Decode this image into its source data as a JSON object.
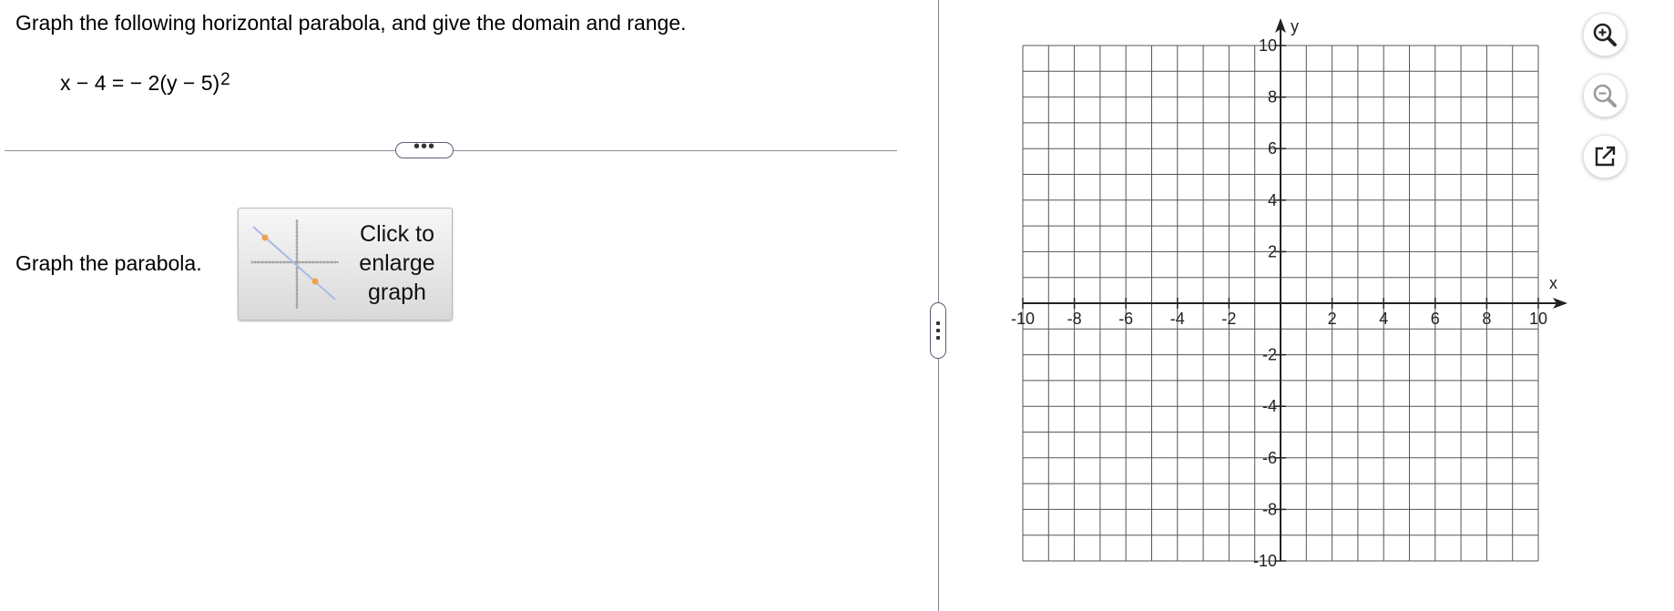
{
  "question": {
    "prompt": "Graph the following horizontal parabola, and give the domain and range.",
    "equation_main": "x − 4 =  − 2(y − 5)",
    "equation_exponent": "2"
  },
  "more_handle": {
    "label": "•••"
  },
  "answer": {
    "prompt": "Graph the parabola.",
    "enlarge_button": {
      "line1": "Click to",
      "line2": "enlarge",
      "line3": "graph"
    }
  },
  "graph": {
    "x_axis_label": "x",
    "y_axis_label": "y",
    "x_range": [
      -10,
      10
    ],
    "y_range": [
      -10,
      10
    ],
    "grid_step": 1,
    "tick_step": 2,
    "x_tick_labels": [
      "-10",
      "-8",
      "-6",
      "-4",
      "-2",
      "2",
      "4",
      "6",
      "8",
      "10"
    ],
    "y_tick_labels": [
      "10",
      "8",
      "6",
      "4",
      "2",
      "-2",
      "-4",
      "-6",
      "-8",
      "-10"
    ],
    "grid_color": "#555555",
    "axis_color": "#222222"
  },
  "tools": [
    {
      "name": "zoom-in-icon",
      "color": "#222222"
    },
    {
      "name": "zoom-out-icon",
      "color": "#9a9a9a"
    },
    {
      "name": "open-external-icon",
      "color": "#222222"
    }
  ],
  "thumbnail": {
    "line_color": "#a9b9e6",
    "point_color": "#f0a04b",
    "axis_color": "#9a9a9a"
  }
}
